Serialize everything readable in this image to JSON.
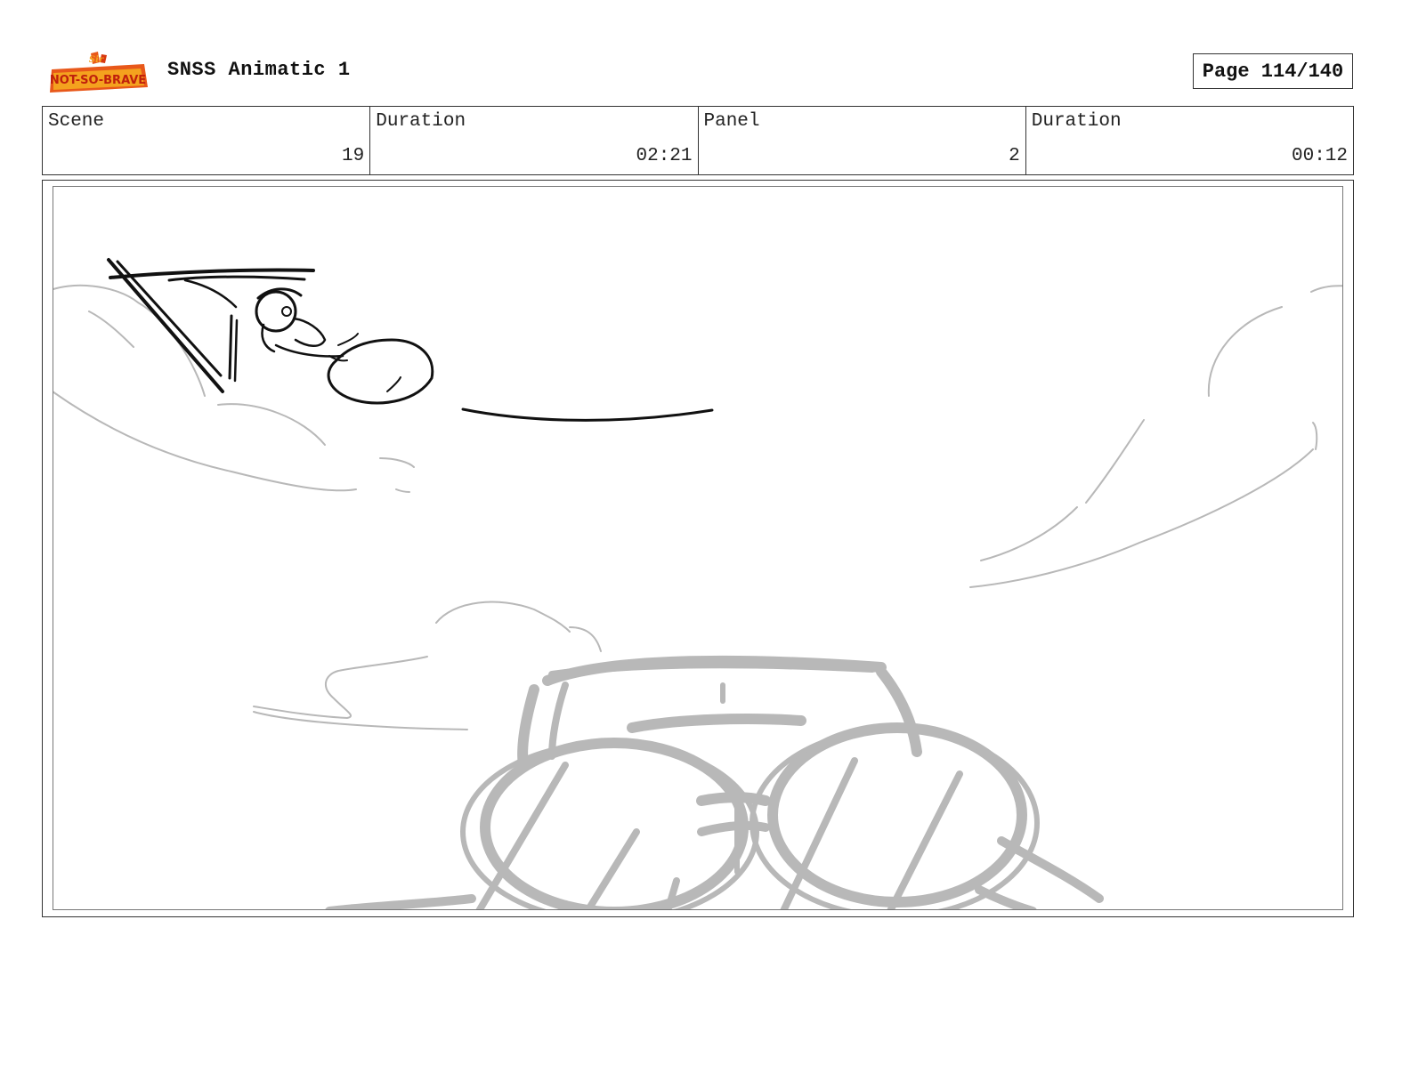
{
  "header": {
    "logo_alt": "Sir Not-So-Brave logo",
    "logo_text_small": "Sir",
    "logo_text_main": "NOT-SO-BRAVE",
    "title": "SNSS Animatic 1",
    "page": "Page 114/140"
  },
  "info": {
    "scene_label": "Scene",
    "scene_value": "19",
    "scene_duration_label": "Duration",
    "scene_duration_value": "02:21",
    "panel_label": "Panel",
    "panel_value": "2",
    "panel_duration_label": "Duration",
    "panel_duration_value": "00:12"
  },
  "panel": {
    "description_icon": "storyboard-sketch",
    "colors": {
      "ink": "#111111",
      "pencil": "#b8b8b8",
      "frame": "#777777"
    }
  }
}
